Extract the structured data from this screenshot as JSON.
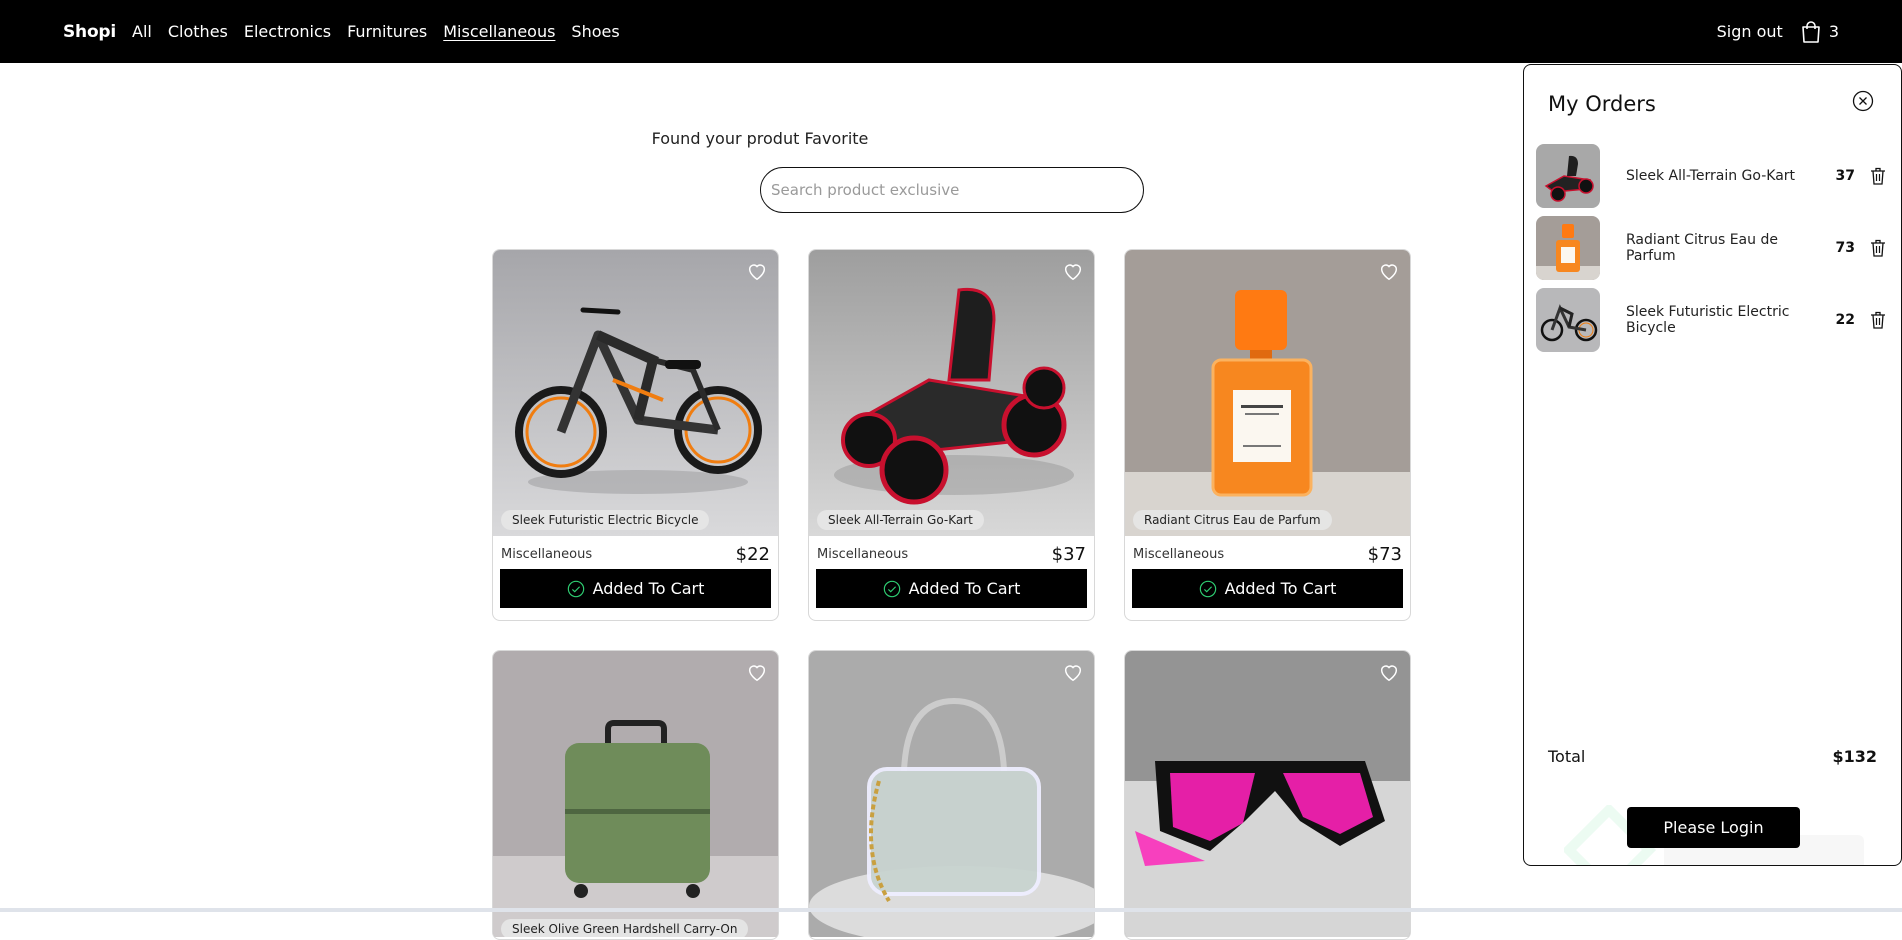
{
  "nav": {
    "brand": "Shopi",
    "links": [
      "All",
      "Clothes",
      "Electronics",
      "Furnitures",
      "Miscellaneous",
      "Shoes"
    ],
    "active": "Miscellaneous",
    "sign_out": "Sign out",
    "cart_count": "3"
  },
  "main": {
    "tagline": "Found your produt Favorite",
    "search_placeholder": "Search product exclusive"
  },
  "products": [
    {
      "name": "Sleek Futuristic Electric Bicycle",
      "category": "Miscellaneous",
      "price": "$22",
      "button": "Added To Cart",
      "image": "electric-bicycle"
    },
    {
      "name": "Sleek All-Terrain Go-Kart",
      "category": "Miscellaneous",
      "price": "$37",
      "button": "Added To Cart",
      "image": "go-kart"
    },
    {
      "name": "Radiant Citrus Eau de Parfum",
      "category": "Miscellaneous",
      "price": "$73",
      "button": "Added To Cart",
      "image": "perfume-bottle"
    },
    {
      "name": "Sleek Olive Green Hardshell Carry-On",
      "image": "green-suitcase"
    },
    {
      "image": "clear-handbag"
    },
    {
      "image": "pink-sunglasses"
    }
  ],
  "orders": {
    "title": "My Orders",
    "items": [
      {
        "name": "Sleek All-Terrain Go-Kart",
        "price": "37",
        "image": "go-kart"
      },
      {
        "name": "Radiant Citrus Eau de Parfum",
        "price": "73",
        "image": "perfume-bottle"
      },
      {
        "name": "Sleek Futuristic Electric Bicycle",
        "price": "22",
        "image": "electric-bicycle"
      }
    ],
    "total_label": "Total",
    "total_value": "$132",
    "login_button": "Please Login"
  },
  "colors": {
    "nav_bg": "#000000",
    "button_bg": "#000000",
    "check": "#2ecc71",
    "accent_orange": "#f07d10"
  }
}
